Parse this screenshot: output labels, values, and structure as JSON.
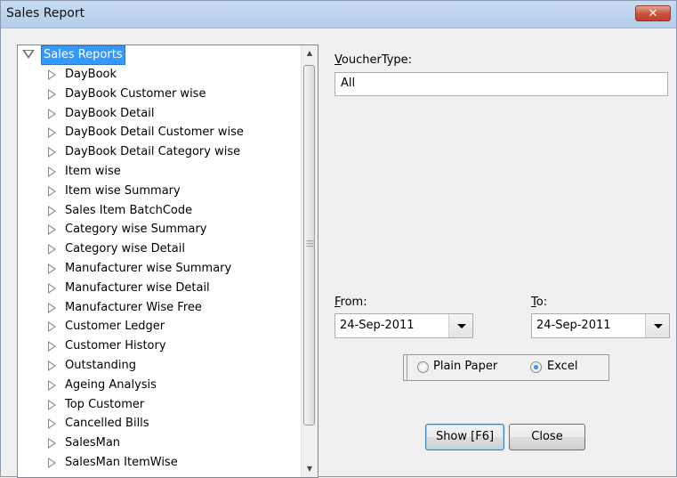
{
  "window": {
    "title": "Sales Report",
    "close_glyph": "✕"
  },
  "tree": {
    "root_label": "Sales Reports",
    "items": [
      "DayBook",
      "DayBook Customer wise",
      "DayBook Detail",
      "DayBook Detail Customer wise",
      "DayBook Detail Category wise",
      "Item wise",
      "Item wise Summary",
      "Sales Item BatchCode",
      "Category wise Summary",
      "Category wise Detail",
      "Manufacturer wise Summary",
      "Manufacturer wise Detail",
      "Manufacturer Wise Free",
      "Customer Ledger",
      "Customer History",
      "Outstanding",
      "Ageing Analysis",
      "Top Customer",
      "Cancelled Bills",
      "SalesMan",
      "SalesMan ItemWise"
    ]
  },
  "voucher": {
    "label_first": "V",
    "label_rest": "oucherType:",
    "value": "All"
  },
  "from": {
    "label_first": "F",
    "label_rest": "rom:",
    "value": "24-Sep-2011"
  },
  "to": {
    "label_first": "T",
    "label_rest": "o:",
    "value": "24-Sep-2011"
  },
  "output": {
    "plain_label": "Plain Paper",
    "excel_label": "Excel",
    "selected": "Excel"
  },
  "buttons": {
    "show": "Show [F6]",
    "close": "Close"
  },
  "colors": {
    "selection": "#3399ff",
    "title_bar": "#b9d1ea",
    "close_button": "#c7432b"
  },
  "icons": {
    "expanded": "triangle-down-icon",
    "collapsed": "triangle-right-icon"
  }
}
